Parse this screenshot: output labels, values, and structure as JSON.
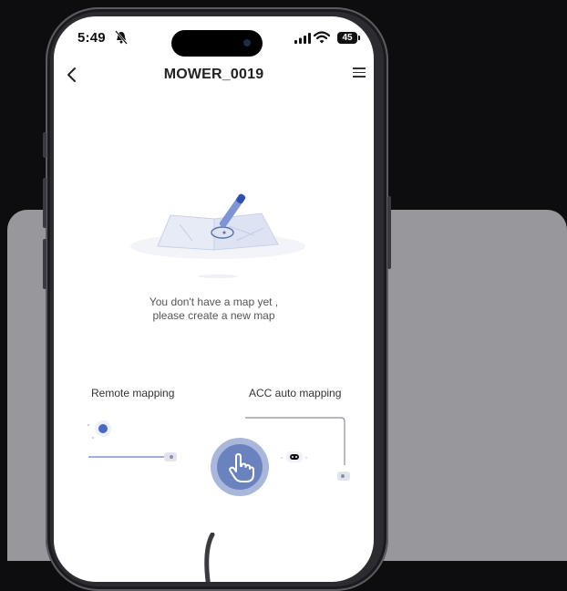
{
  "status_bar": {
    "time": "5:49",
    "battery": "45"
  },
  "header": {
    "title": "MOWER_0019"
  },
  "empty_state": {
    "line1": "You don't have a map yet ,",
    "line2": "please create a new map"
  },
  "options": {
    "remote_label": "Remote mapping",
    "acc_label": "ACC auto mapping"
  },
  "colors": {
    "accent": "#4a68c6",
    "tap_indicator": "#6a83bf",
    "backdrop": "#98979c"
  },
  "icons": [
    "back-chevron-icon",
    "menu-list-icon",
    "bell-slash-icon",
    "signal-icon",
    "wifi-icon",
    "battery-icon",
    "map-pencil-icon",
    "robot-icon",
    "hand-pointer-icon"
  ]
}
